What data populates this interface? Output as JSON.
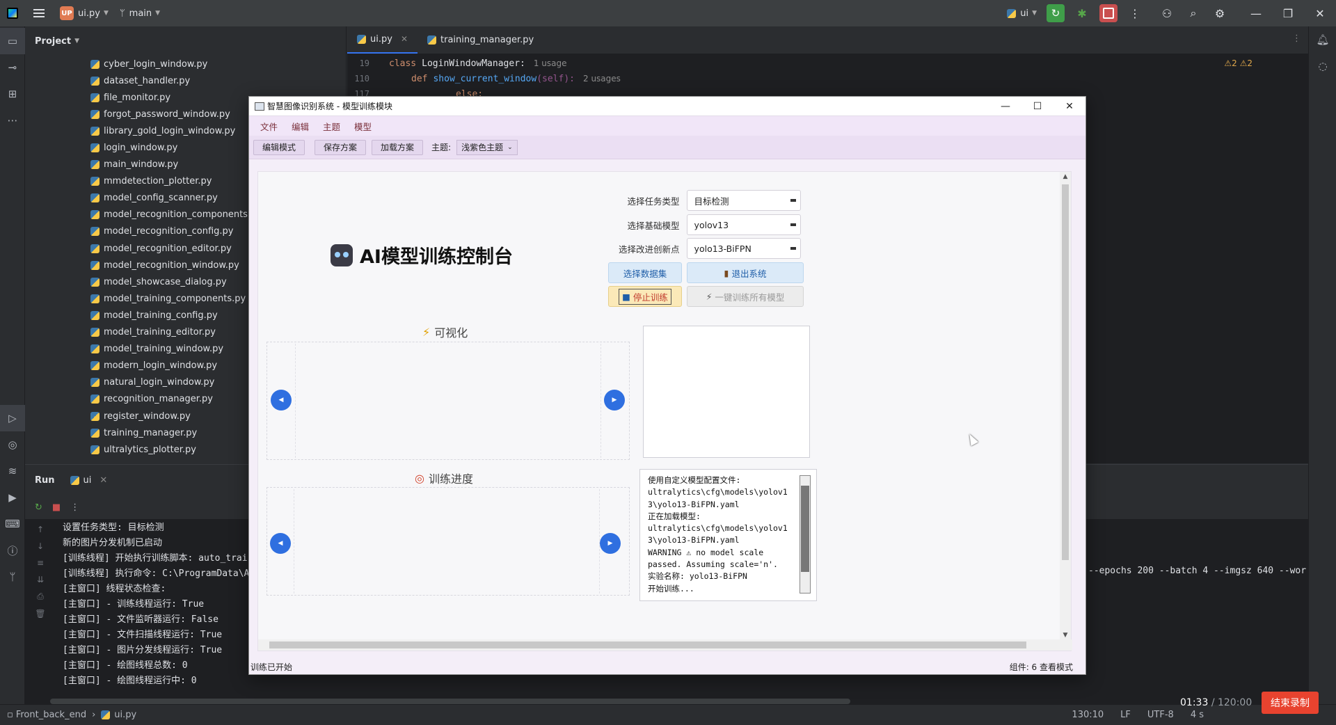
{
  "ide": {
    "project_name": "ui.py",
    "project_badge": "UP",
    "branch": "main",
    "run_config": "ui"
  },
  "project_panel": {
    "title": "Project",
    "files": [
      "cyber_login_window.py",
      "dataset_handler.py",
      "file_monitor.py",
      "forgot_password_window.py",
      "library_gold_login_window.py",
      "login_window.py",
      "main_window.py",
      "mmdetection_plotter.py",
      "model_config_scanner.py",
      "model_recognition_components.py",
      "model_recognition_config.py",
      "model_recognition_editor.py",
      "model_recognition_window.py",
      "model_showcase_dialog.py",
      "model_training_components.py",
      "model_training_config.py",
      "model_training_editor.py",
      "model_training_window.py",
      "modern_login_window.py",
      "natural_login_window.py",
      "recognition_manager.py",
      "register_window.py",
      "training_manager.py",
      "ultralytics_plotter.py"
    ]
  },
  "editor": {
    "tabs": [
      {
        "label": "ui.py"
      },
      {
        "label": "training_manager.py"
      }
    ],
    "lines": [
      {
        "num": "19",
        "kw": "class",
        "name": "LoginWindowManager:",
        "usage": "1 usage"
      },
      {
        "num": "110",
        "kw": "def",
        "name": "show_current_window",
        "args": "(self):",
        "usage": "2 usages"
      },
      {
        "num": "117",
        "kw": "else:"
      }
    ],
    "warnings": "⚠2 ⚠2"
  },
  "run_panel": {
    "title": "Run",
    "tab": "ui",
    "console": [
      "设置任务类型: 目标检测",
      "新的图片分发机制已启动",
      "[训练线程] 开始执行训练脚本: auto_trai",
      "[训练线程] 执行命令: C:\\ProgramData\\A",
      "[主窗口] 线程状态检查:",
      "[主窗口] - 训练线程运行: True",
      "[主窗口] - 文件监听器运行: False",
      "[主窗口] - 文件扫描线程运行: True",
      "[主窗口] - 图片分发线程运行: True",
      "[主窗口] - 绘图线程总数: 0",
      "[主窗口] - 绘图线程运行中: 0"
    ],
    "console_tail": "--epochs 200 --batch 4 --imgsz 640 --wor"
  },
  "statusbar": {
    "breadcrumb_root": "Front_back_end",
    "breadcrumb_file": "ui.py",
    "position": "130:10",
    "line_sep": "LF",
    "encoding": "UTF-8",
    "indent": "4 s"
  },
  "recording": {
    "elapsed": "01:33",
    "limit": "/ 120:00",
    "end_label": "结束录制"
  },
  "app_window": {
    "title": "智慧图像识别系统 - 模型训练模块",
    "menu": [
      "文件",
      "编辑",
      "主题",
      "模型"
    ],
    "toolbar": {
      "edit_mode": "编辑模式",
      "save_plan": "保存方案",
      "load_plan": "加载方案",
      "theme_label": "主题:",
      "theme_value": "浅紫色主题"
    },
    "console_title": "AI模型训练控制台",
    "form": {
      "task_label": "选择任务类型",
      "task_value": "目标检测",
      "base_label": "选择基础模型",
      "base_value": "yolov13",
      "improve_label": "选择改进创新点",
      "improve_value": "yolo13-BiFPN"
    },
    "buttons": {
      "select_dataset": "选择数据集",
      "exit_system": "退出系统",
      "stop_training": "停止训练",
      "train_all": "一键训练所有模型"
    },
    "visualize_title": "可视化",
    "progress_title": "训练进度",
    "log_text": "使用自定义模型配置文件:\nultralytics\\cfg\\models\\yolov1\n3\\yolo13-BiFPN.yaml\n正在加载模型:\nultralytics\\cfg\\models\\yolov1\n3\\yolo13-BiFPN.yaml\nWARNING ⚠ no model scale\npassed. Assuming scale='n'.\n实验名称: yolo13-BiFPN\n开始训练...",
    "status_left": "训练已开始",
    "status_right": "组件: 6  查看模式"
  },
  "colors": {
    "ide_bg": "#2b2d30",
    "editor_bg": "#1e1f22",
    "accent_blue": "#3574f0",
    "app_bg": "#f4eef8",
    "nav_blue": "#2f6fe0",
    "record_red": "#e8432f"
  }
}
